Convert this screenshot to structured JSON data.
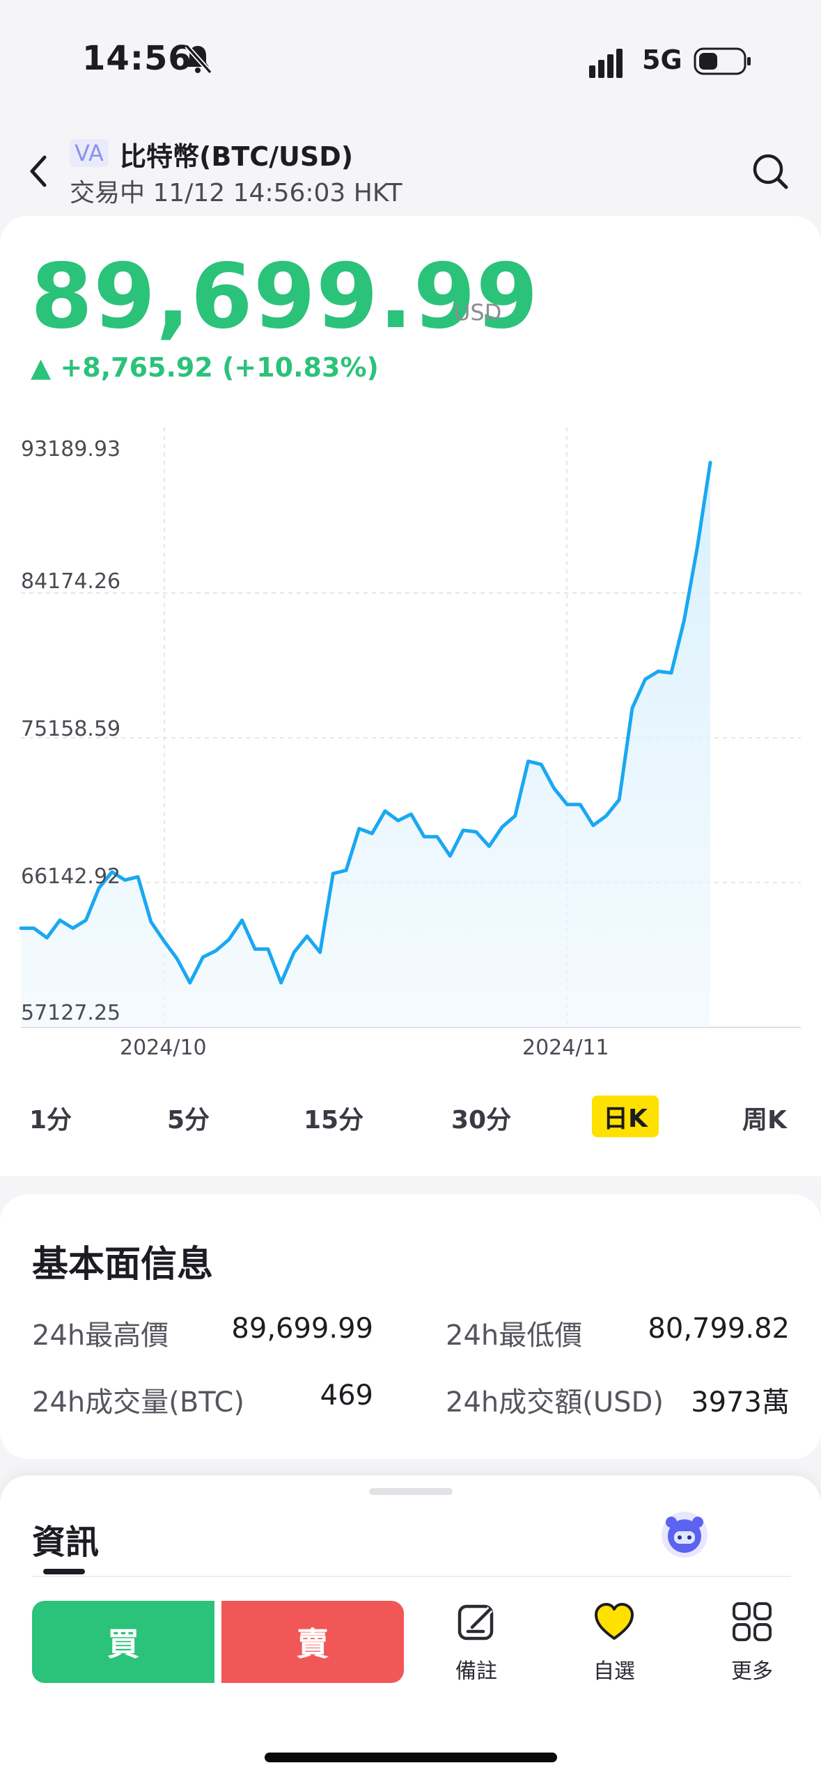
{
  "status_bar": {
    "time": "14:56",
    "network": "5G"
  },
  "header": {
    "badge": "VA",
    "title": "比特幣(BTC/USD)",
    "subtitle": "交易中 11/12 14:56:03 HKT"
  },
  "quote": {
    "price": "89,699.99",
    "unit": "USD",
    "change": "▲ +8,765.92 (+10.83%)",
    "colors": {
      "up": "#2bc27a",
      "down": "#f25757",
      "line": "#1aa8f0"
    }
  },
  "chart_data": {
    "type": "area",
    "y_ticks": [
      "93189.93",
      "84174.26",
      "75158.59",
      "66142.92",
      "57127.25"
    ],
    "ylim": [
      57127.25,
      93189.93
    ],
    "x_ticks": [
      "2024/10",
      "2024/11"
    ],
    "grid": true,
    "values": [
      63300,
      63300,
      62700,
      63800,
      63300,
      63800,
      65800,
      66800,
      66300,
      66500,
      63700,
      62500,
      61400,
      59900,
      61500,
      61900,
      62600,
      63800,
      62000,
      62000,
      59900,
      61800,
      62800,
      61800,
      66700,
      66900,
      69500,
      69200,
      70600,
      70000,
      70400,
      69000,
      69000,
      67800,
      69400,
      69300,
      68400,
      69600,
      70300,
      73700,
      73500,
      72000,
      71000,
      71000,
      69700,
      70300,
      71300,
      77000,
      78800,
      79300,
      79200,
      82500,
      87000,
      92300
    ]
  },
  "timeframes": [
    "1分",
    "5分",
    "15分",
    "30分",
    "日K",
    "周K"
  ],
  "active_timeframe": "日K",
  "fundamentals": {
    "title": "基本面信息",
    "rows": [
      {
        "label": "24h最高價",
        "value": "89,699.99"
      },
      {
        "label": "24h最低價",
        "value": "80,799.82"
      },
      {
        "label": "24h成交量(BTC)",
        "value": "469"
      },
      {
        "label": "24h成交額(USD)",
        "value": "3973萬"
      }
    ]
  },
  "news": {
    "tab": "資訊"
  },
  "bottom_bar": {
    "buy": "買",
    "sell": "賣",
    "note": "備註",
    "watchlist": "自選",
    "more": "更多"
  },
  "icons": [
    "bell-slash-icon",
    "signal-icon",
    "battery-icon",
    "back-icon",
    "search-icon",
    "robot-icon",
    "note-icon",
    "heart-icon",
    "grid-icon"
  ]
}
